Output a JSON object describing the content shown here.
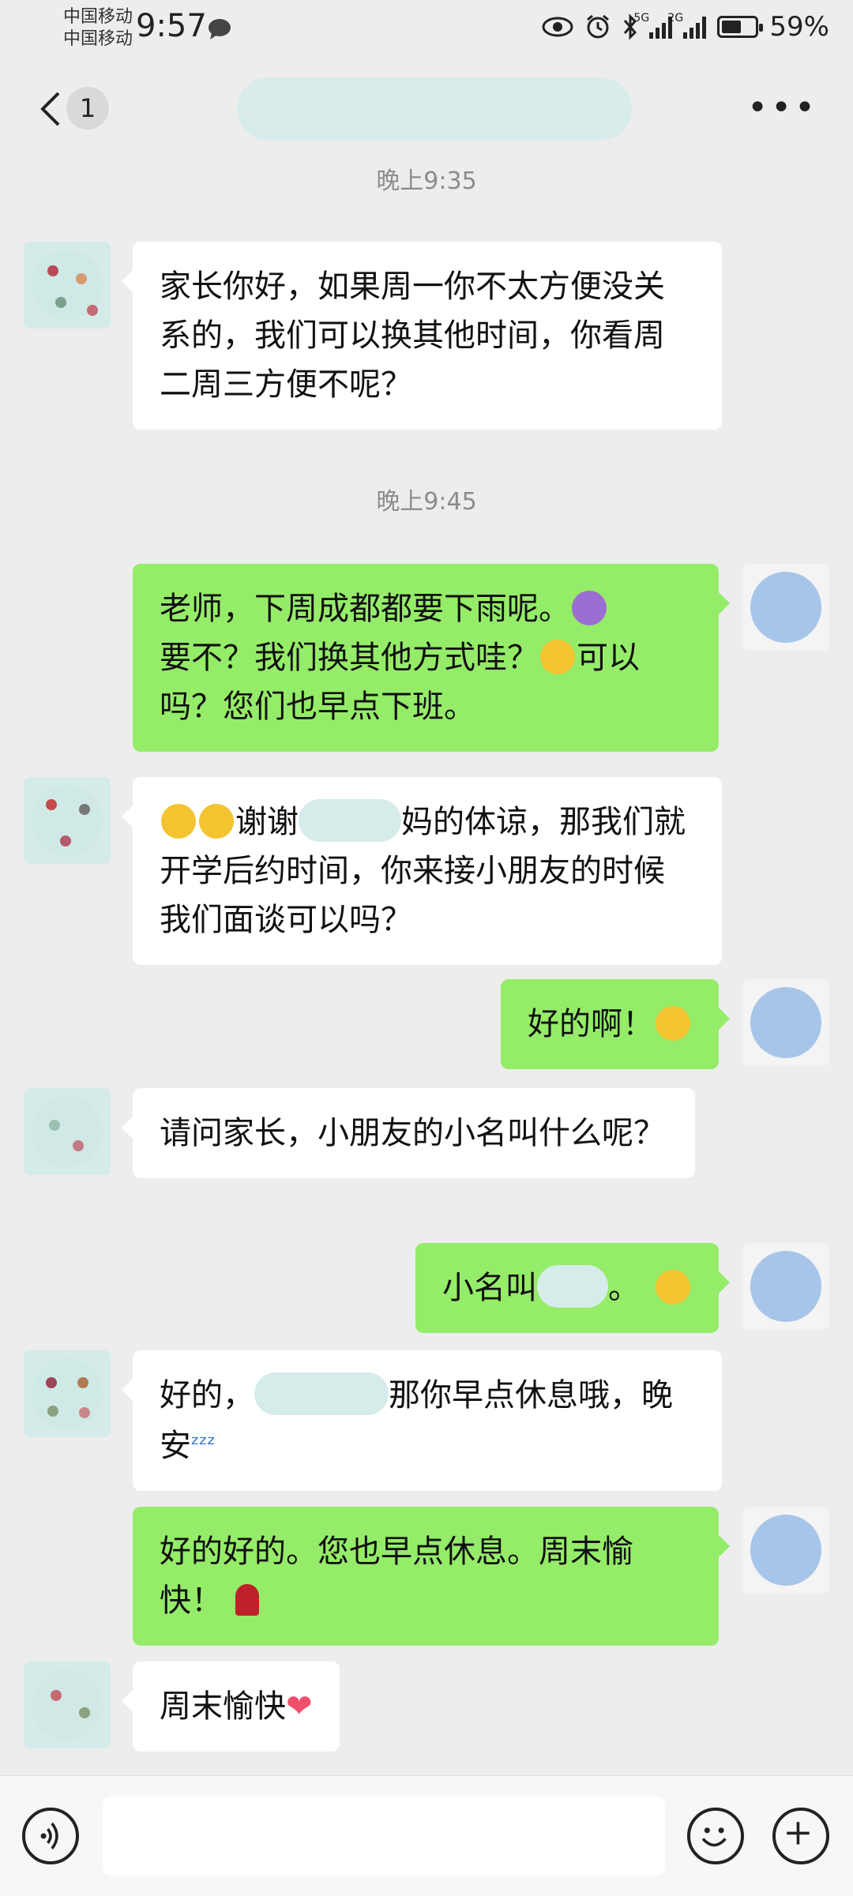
{
  "status_bar": {
    "carrier_1": "中国移动",
    "carrier_2": "中国移动",
    "time": "9:57",
    "battery": "59%",
    "battery_level": 0.59,
    "net_1": "5G",
    "net_2": "2G"
  },
  "header": {
    "unread_count": "1",
    "more": "•••"
  },
  "timestamps": [
    "晚上9:35",
    "晚上9:45"
  ],
  "messages": [
    {
      "from": "teacher",
      "text": "家长你好，如果周一你不太方便没关系的，我们可以换其他时间，你看周二周三方便不呢？"
    },
    {
      "from": "me",
      "text_a": "老师，下周成都都要下雨呢。",
      "text_b": "要不？我们换其他方式哇？",
      "text_c": "可以吗？您们也早点下班。",
      "emoji_1": "umbrella-rain-emoji",
      "emoji_2": "flushed-emoji"
    },
    {
      "from": "teacher",
      "text_a": "谢谢",
      "text_b": "妈的体谅，那我们就开学后约时间，你来接小朋友的时候我们面谈可以吗？",
      "emoji": "face-with-hand-over-mouth-emoji"
    },
    {
      "from": "me",
      "text": "好的啊！",
      "emoji": "winking-tongue-emoji"
    },
    {
      "from": "teacher",
      "text": "请问家长，小朋友的小名叫什么呢？"
    },
    {
      "from": "me",
      "text_a": "小名叫",
      "text_b": "。",
      "emoji": "grinning-emoji"
    },
    {
      "from": "teacher",
      "text_a": "好的，",
      "text_b": "那你早点休息哦，晚安",
      "emoji": "zzz-emoji"
    },
    {
      "from": "me",
      "text": "好的好的。您也早点休息。周末愉快！",
      "emoji": "rose-emoji"
    },
    {
      "from": "teacher",
      "text": "周末愉快",
      "emoji": "heart-emoji"
    }
  ],
  "icons": {
    "back": "chevron-left-icon",
    "voice": "voice-icon",
    "emoji": "emoji-icon",
    "plus": "plus-icon",
    "notification": "chat-bubble-icon"
  }
}
